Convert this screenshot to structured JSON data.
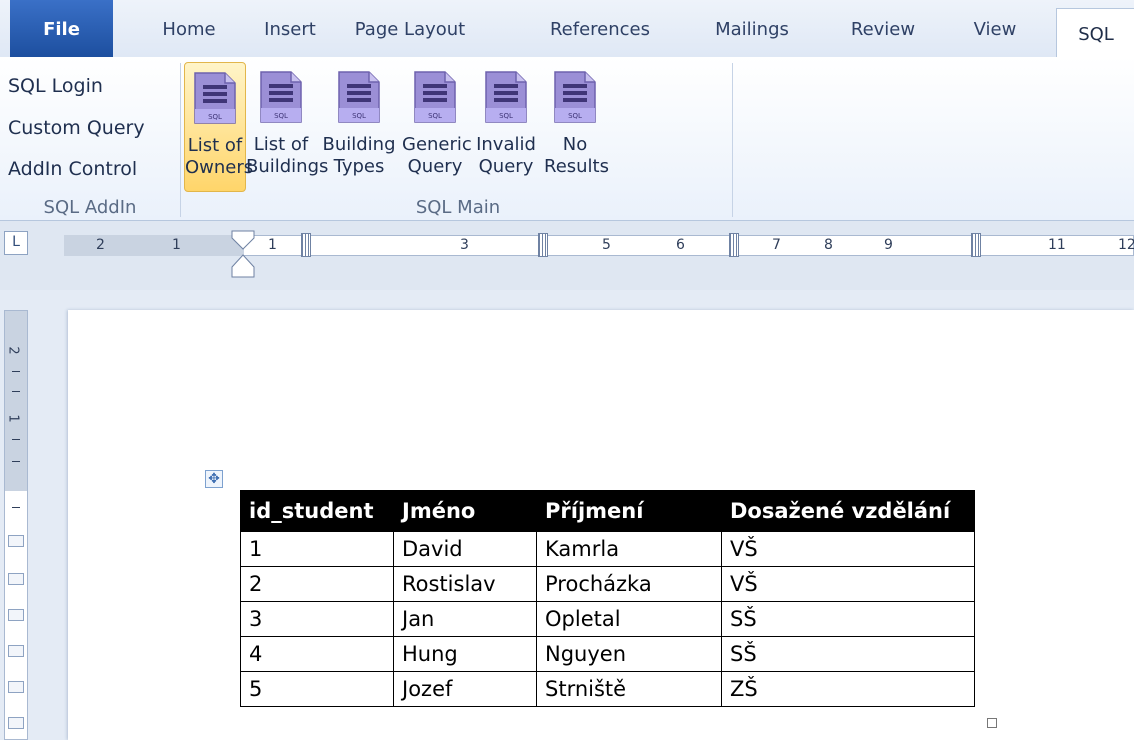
{
  "tabs": {
    "file": "File",
    "items": [
      "Home",
      "Insert",
      "Page Layout",
      "References",
      "Mailings",
      "Review",
      "View",
      "SQL"
    ]
  },
  "ribbon": {
    "sql_addin": {
      "buttons": [
        "SQL Login",
        "Custom Query",
        "AddIn Control"
      ],
      "label": "SQL AddIn"
    },
    "sql_main": {
      "label": "SQL Main",
      "buttons": [
        {
          "label": "List of\nOwners",
          "icon": "sql-document-icon",
          "selected": true
        },
        {
          "label": "List of\nBuildings",
          "icon": "sql-document-icon",
          "selected": false
        },
        {
          "label": "Building\nTypes",
          "icon": "sql-document-icon",
          "selected": false
        },
        {
          "label": "Generic\nQuery",
          "icon": "sql-document-icon",
          "selected": false
        },
        {
          "label": "Invalid\nQuery",
          "icon": "sql-document-icon",
          "selected": false
        },
        {
          "label": "No\nResults",
          "icon": "sql-document-icon",
          "selected": false
        }
      ],
      "icon_text": "SQL"
    }
  },
  "ruler": {
    "corner": "L",
    "ticks": [
      "2",
      "1",
      "1",
      "3",
      "5",
      "6",
      "7",
      "8",
      "9",
      "11",
      "12"
    ]
  },
  "vruler": {
    "labels": [
      "2",
      "1"
    ]
  },
  "table": {
    "headers": [
      "id_student",
      "Jméno",
      "Příjmení",
      "Dosažené vzdělání"
    ],
    "rows": [
      [
        "1",
        "David",
        "Kamrla",
        "VŠ"
      ],
      [
        "2",
        "Rostislav",
        "Procházka",
        "VŠ"
      ],
      [
        "3",
        "Jan",
        "Opletal",
        "SŠ"
      ],
      [
        "4",
        "Hung",
        "Nguyen",
        "SŠ"
      ],
      [
        "5",
        "Jozef",
        "Strniště",
        "ZŠ"
      ]
    ]
  },
  "colors": {
    "file_tab": "#2a5fb5",
    "selected_button": "#ffd56a",
    "icon_purple": "#9b8fd6",
    "header_row": "#000000"
  }
}
